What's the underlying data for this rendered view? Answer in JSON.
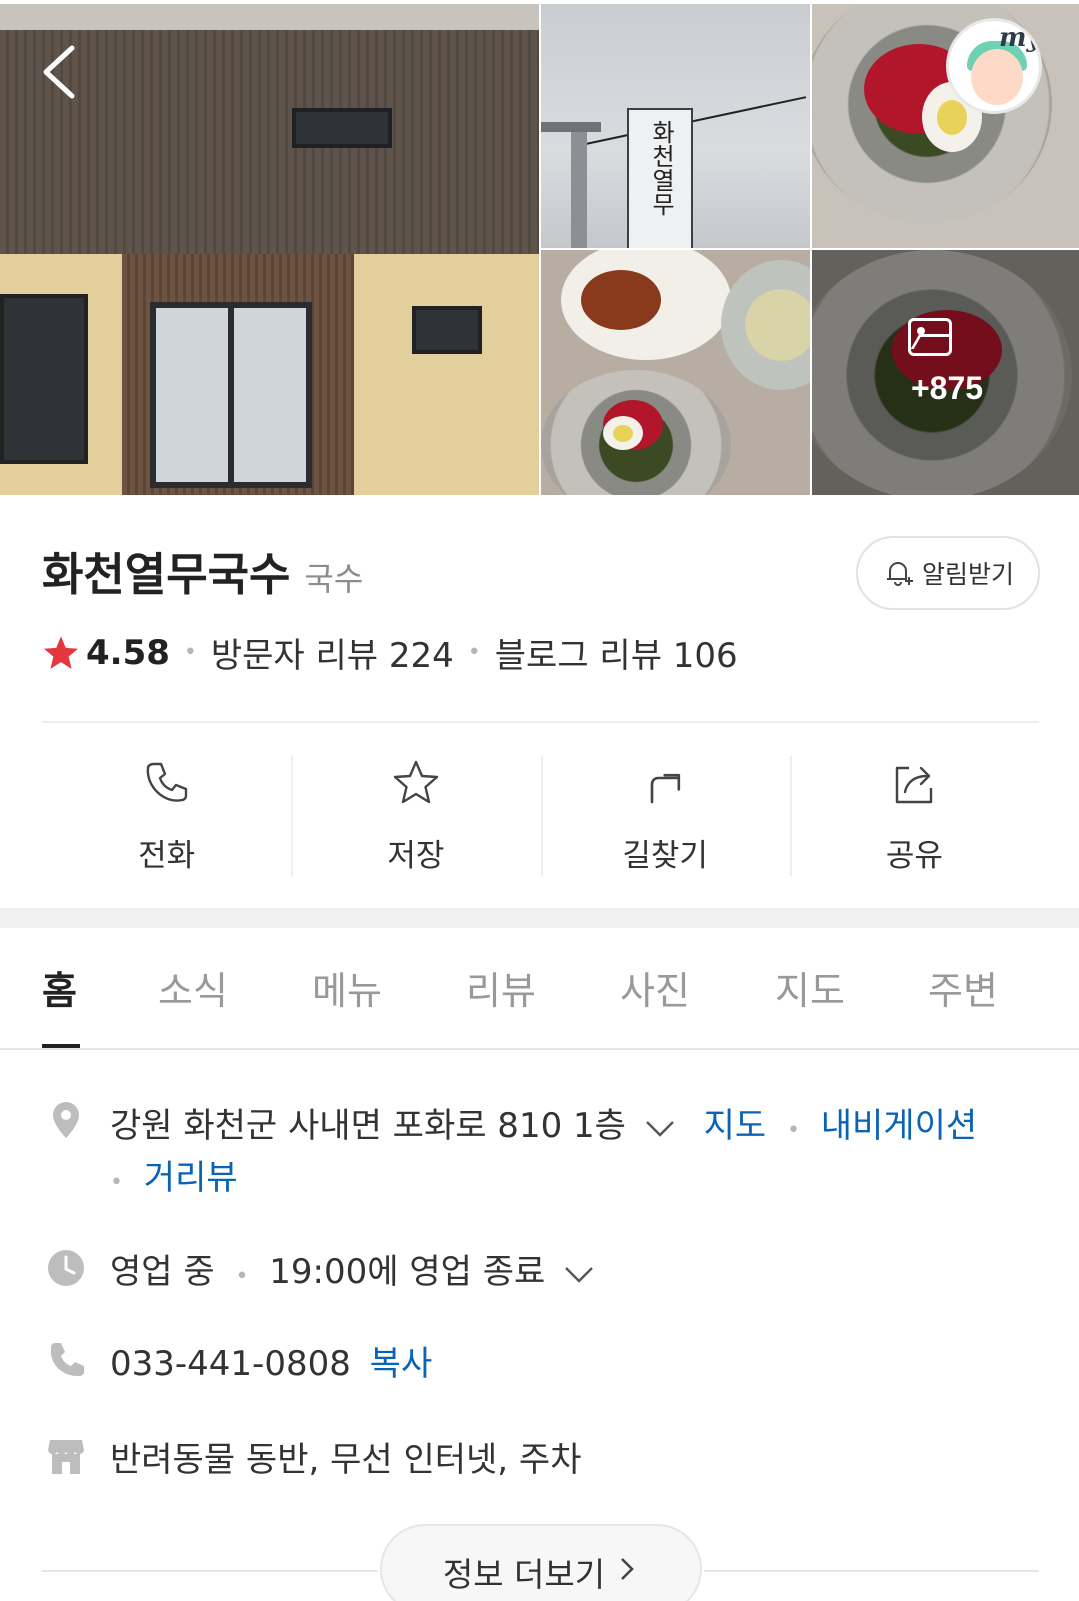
{
  "gallery": {
    "sign_text": "화천열무",
    "more_count": "+875",
    "my_badge": "my"
  },
  "place": {
    "name": "화천열무국수",
    "category": "국수",
    "alarm_label": "알림받기",
    "rating": "4.58",
    "visitor_review": "방문자 리뷰 224",
    "blog_review": "블로그 리뷰 106"
  },
  "actions": [
    {
      "label": "전화",
      "icon": "phone-icon"
    },
    {
      "label": "저장",
      "icon": "star-icon"
    },
    {
      "label": "길찾기",
      "icon": "directions-icon"
    },
    {
      "label": "공유",
      "icon": "share-icon"
    }
  ],
  "tabs": [
    {
      "label": "홈",
      "active": true
    },
    {
      "label": "소식"
    },
    {
      "label": "메뉴"
    },
    {
      "label": "리뷰"
    },
    {
      "label": "사진"
    },
    {
      "label": "지도"
    },
    {
      "label": "주변"
    }
  ],
  "info": {
    "address": "강원 화천군 사내면 포화로 810 1층",
    "map_link": "지도",
    "navigation_link": "내비게이션",
    "streetview_link": "거리뷰",
    "status": "영업 중",
    "hours": "19:00에 영업 종료",
    "phone": "033-441-0808",
    "copy_link": "복사",
    "amenities": "반려동물 동반, 무선 인터넷, 주차",
    "more_info": "정보 더보기"
  },
  "colors": {
    "star": "#e5363d",
    "link": "#0b63b5",
    "icon_gray": "#bdbdbd"
  }
}
